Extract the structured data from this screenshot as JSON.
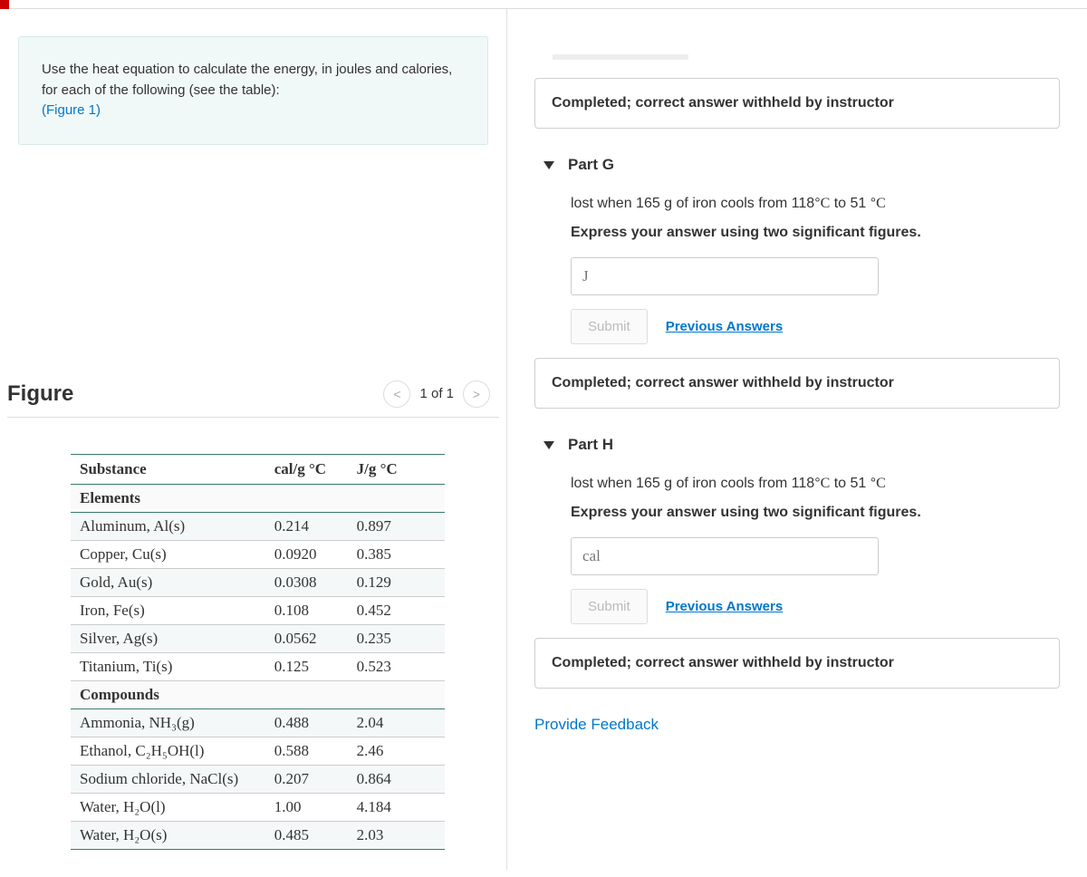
{
  "instruction": {
    "text1": "Use the heat equation to calculate the energy, in joules and calories, for each of the following (see the table):",
    "figure_link": "(Figure 1)"
  },
  "figure": {
    "title": "Figure",
    "nav_count": "1 of 1",
    "headers": {
      "c1": "Substance",
      "c2": "cal/g °C",
      "c3": "J/g °C"
    },
    "section1": "Elements",
    "section2": "Compounds",
    "elements": [
      {
        "name": "Aluminum, Al(s)",
        "cal": "0.214",
        "j": "0.897"
      },
      {
        "name": "Copper, Cu(s)",
        "cal": "0.0920",
        "j": "0.385"
      },
      {
        "name": "Gold, Au(s)",
        "cal": "0.0308",
        "j": "0.129"
      },
      {
        "name": "Iron, Fe(s)",
        "cal": "0.108",
        "j": "0.452"
      },
      {
        "name": "Silver, Ag(s)",
        "cal": "0.0562",
        "j": "0.235"
      },
      {
        "name": "Titanium, Ti(s)",
        "cal": "0.125",
        "j": "0.523"
      }
    ],
    "compounds": [
      {
        "name": "Ammonia, NH₃(g)",
        "cal": "0.488",
        "j": "2.04"
      },
      {
        "name": "Ethanol, C₂H₅OH(l)",
        "cal": "0.588",
        "j": "2.46"
      },
      {
        "name": "Sodium chloride, NaCl(s)",
        "cal": "0.207",
        "j": "0.864"
      },
      {
        "name": "Water, H₂O(l)",
        "cal": "1.00",
        "j": "4.184"
      },
      {
        "name": "Water, H₂O(s)",
        "cal": "0.485",
        "j": "2.03"
      }
    ]
  },
  "right": {
    "completed_msg": "Completed; correct answer withheld by instructor",
    "part_g": {
      "title": "Part G",
      "question": "lost when 165 g of iron cools from 118°C to 51 °C",
      "instr": "Express your answer using two significant figures.",
      "placeholder": "J",
      "submit": "Submit",
      "prev": "Previous Answers"
    },
    "part_h": {
      "title": "Part H",
      "question": "lost when 165 g of iron cools from 118°C to 51 °C",
      "instr": "Express your answer using two significant figures.",
      "placeholder": "cal",
      "submit": "Submit",
      "prev": "Previous Answers"
    },
    "feedback": "Provide Feedback"
  }
}
